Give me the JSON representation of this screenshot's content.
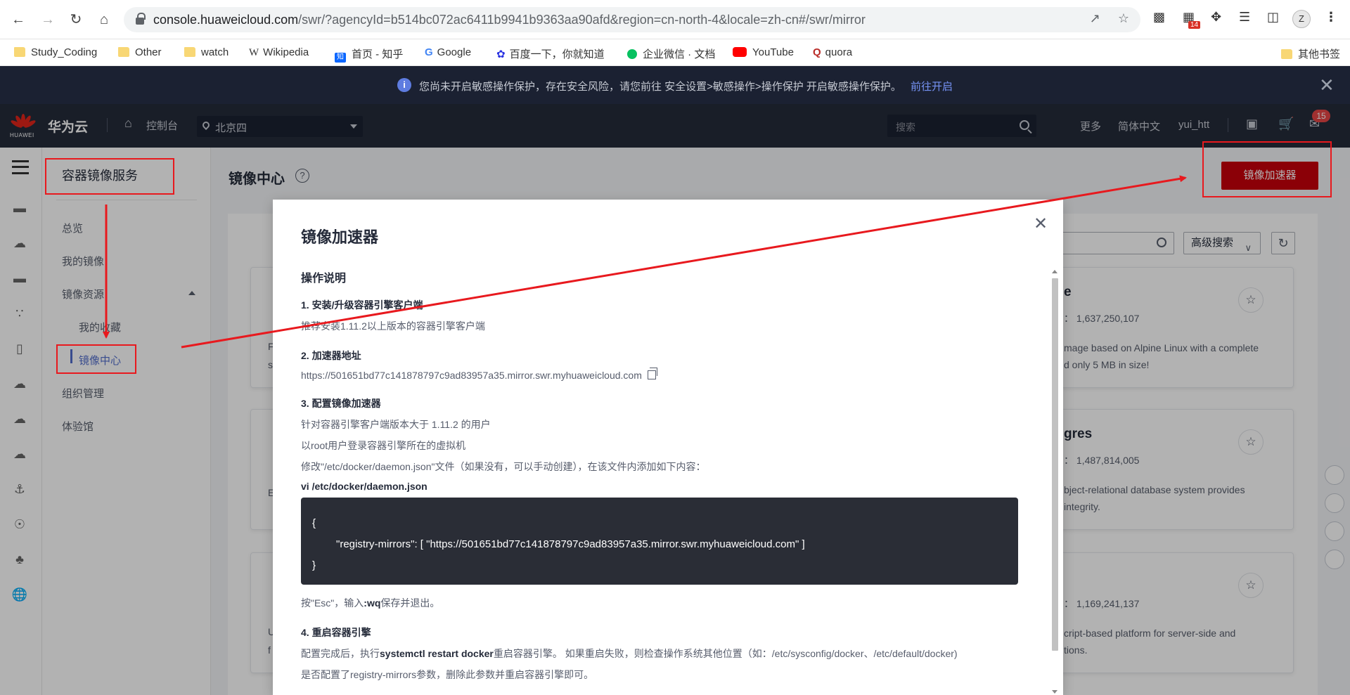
{
  "browser": {
    "url_host": "console.huaweicloud.com",
    "url_path": "/swr/?agencyId=b514bc072ac6411b9941b9363aa90afd&region=cn-north-4&locale=zh-cn#/swr/mirror",
    "extension_badge": "14",
    "profile_initial": "Z"
  },
  "bookmarks": [
    {
      "label": "Study_Coding",
      "icon": "folder-icon"
    },
    {
      "label": "Other",
      "icon": "folder-icon"
    },
    {
      "label": "watch",
      "icon": "folder-icon"
    },
    {
      "label": "Wikipedia",
      "icon": "wikipedia-icon"
    },
    {
      "label": "首页 - 知乎",
      "icon": "zhihu-icon"
    },
    {
      "label": "Google",
      "icon": "google-icon"
    },
    {
      "label": "百度一下，你就知道",
      "icon": "baidu-icon"
    },
    {
      "label": "企业微信 · 文档",
      "icon": "wecom-icon"
    },
    {
      "label": "YouTube",
      "icon": "youtube-icon"
    },
    {
      "label": "quora",
      "icon": "quora-icon"
    },
    {
      "label": "其他书签",
      "icon": "folder-icon"
    }
  ],
  "alert": {
    "text": "您尚未开启敏感操作保护，存在安全风险，请您前往 安全设置>敏感操作>操作保护 开启敏感操作保护。",
    "link": "前往开启"
  },
  "topnav": {
    "logo_caption": "HUAWEI",
    "brand": "华为云",
    "console": "控制台",
    "region": "北京四",
    "search_placeholder": "搜索",
    "more": "更多",
    "language": "简体中文",
    "user": "yui_htt",
    "message_count": "15"
  },
  "sidebar": {
    "title": "容器镜像服务",
    "items": [
      {
        "label": "总览"
      },
      {
        "label": "我的镜像"
      },
      {
        "label": "镜像资源"
      },
      {
        "label": "我的收藏"
      },
      {
        "label": "镜像中心"
      },
      {
        "label": "组织管理"
      },
      {
        "label": "体验馆"
      }
    ]
  },
  "page": {
    "title": "镜像中心",
    "accelerator_button": "镜像加速器",
    "advanced_search": "高级搜索"
  },
  "cards": [
    {
      "name": "e",
      "downloads_label": "：",
      "downloads": "1,637,250,107",
      "desc": "mage based on Alpine Linux with a complete",
      "desc2": "d only 5 MB in size!",
      "left_text": "F",
      "left_text2": "s"
    },
    {
      "name": "gres",
      "downloads_label": "：",
      "downloads": "1,487,814,005",
      "desc": "bject-relational database system provides",
      "desc2": "integrity.",
      "left_text": "E",
      "left_text2": ""
    },
    {
      "name": "",
      "downloads_label": "：",
      "downloads": "1,169,241,137",
      "desc": "cript-based platform for server-side and",
      "desc2": "tions.",
      "left_text": "U",
      "left_text2": "f"
    }
  ],
  "modal": {
    "title": "镜像加速器",
    "section": "操作说明",
    "step1_title": "1. 安装/升级容器引擎客户端",
    "step1_text": "推荐安装1.11.2以上版本的容器引擎客户端",
    "step2_title": "2. 加速器地址",
    "step2_address": "https://501651bd77c141878797c9ad83957a35.mirror.swr.myhuaweicloud.com",
    "step3_title": "3. 配置镜像加速器",
    "step3_line1": "针对容器引擎客户端版本大于 1.11.2 的用户",
    "step3_line2": "以root用户登录容器引擎所在的虚拟机",
    "step3_line3": "修改\"/etc/docker/daemon.json\"文件（如果没有，可以手动创建），在该文件内添加如下内容：",
    "step3_cmd": "vi /etc/docker/daemon.json",
    "code_open": "{",
    "code_line": "\"registry-mirrors\": [ \"https://501651bd77c141878797c9ad83957a35.mirror.swr.myhuaweicloud.com\" ]",
    "code_close": "}",
    "step3_after_pre": "按\"Esc\"，输入",
    "step3_after_bold": ":wq",
    "step3_after_post": "保存并退出。",
    "step4_title": "4. 重启容器引擎",
    "step4_line1_pre": "配置完成后，执行",
    "step4_line1_bold": "systemctl restart docker",
    "step4_line1_post": "重启容器引擎。 如果重启失败，则检查操作系统其他位置（如：/etc/sysconfig/docker、/etc/default/docker)",
    "step4_line2": "是否配置了registry-mirrors参数，删除此参数并重启容器引擎即可。"
  },
  "colors": {
    "accent_red": "#c7000b",
    "annotation_red": "#e8191e",
    "nav_dark": "#252b3a",
    "link_blue": "#526ecc"
  }
}
